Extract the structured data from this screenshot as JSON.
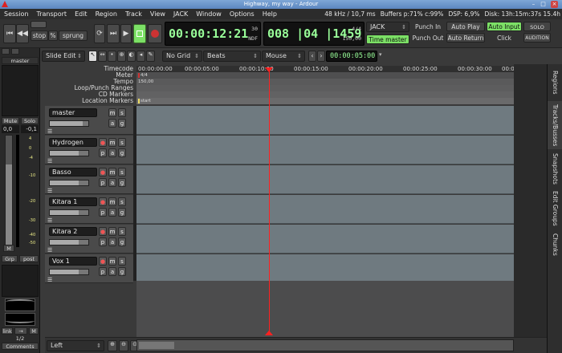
{
  "window": {
    "title": "Highway, my way - Ardour"
  },
  "menu": {
    "items": [
      "Session",
      "Transport",
      "Edit",
      "Region",
      "Track",
      "View",
      "JACK",
      "Window",
      "Options",
      "Help"
    ]
  },
  "status": {
    "samplerate": "48 kHz / 10,7 ms",
    "buffers": "Buffers p:71% c:99%",
    "dsp_label": "DSP:",
    "dsp_value": "6,9%",
    "disk": "Disk: 13h:15m:37s 15.4h"
  },
  "transport": {
    "stop_label": "stop",
    "percent_label": "%",
    "sprung_label": "sprung",
    "primary_clock": "00:00:12:21",
    "primary_clock_fps": "30",
    "primary_clock_mode": "NDF",
    "secondary_clock": "008 |04 |1459",
    "secondary_clock_meter": "4/4",
    "secondary_clock_tempo": "150,00",
    "sync_source": "JACK",
    "time_master_label": "Time master",
    "punch_in_label": "Punch In",
    "punch_out_label": "Punch Out",
    "auto_play_label": "Auto Play",
    "auto_return_label": "Auto Return",
    "auto_input_label": "Auto Input",
    "click_label": "Click",
    "solo_label": "SOLO",
    "audition_label": "AUDITION"
  },
  "edit_toolbar": {
    "edit_mode": "Slide Edit",
    "grid_mode": "No Grid",
    "grid_unit": "Beats",
    "snap_mode": "Mouse",
    "nudge_clock": "00:00:05:00"
  },
  "strip": {
    "name": "master",
    "mute_label": "Mute",
    "solo_label": "Solo",
    "gain_value": "0,0",
    "peak_value": "-0,1",
    "meter_scale": [
      "4",
      "0",
      "-4",
      "-10",
      "-20",
      "-30",
      "-40",
      "-50"
    ],
    "m_label": "M",
    "grp_label": "Grp",
    "post_label": "post",
    "link_label": "link",
    "m2_label": "M",
    "page_label": "1/2",
    "comments_label": "Comments"
  },
  "rulers": {
    "timecode_label": "Timecode",
    "meter_label": "Meter",
    "tempo_label": "Tempo",
    "loop_punch_label": "Loop/Punch Ranges",
    "cd_markers_label": "CD Markers",
    "location_markers_label": "Location Markers",
    "timecode_ticks": [
      "00:00:00:00",
      "00:00:05:00",
      "00:00:10:00",
      "00:00:15:00",
      "00:00:20:00",
      "00:00:25:00",
      "00:00:30:00",
      "00:00"
    ],
    "meter_marker": "4/4",
    "tempo_marker": "150,00",
    "start_marker": "start"
  },
  "tracks": [
    {
      "name": "master",
      "buttons": [
        "m",
        "s",
        "a",
        "g"
      ],
      "gain": 0.85
    },
    {
      "name": "Hydrogen",
      "buttons": [
        "m",
        "s",
        "p",
        "a",
        "g"
      ],
      "gain": 0.75
    },
    {
      "name": "Basso",
      "buttons": [
        "m",
        "s",
        "p",
        "a",
        "g"
      ],
      "gain": 0.75
    },
    {
      "name": "Kitara 1",
      "buttons": [
        "m",
        "s",
        "p",
        "a",
        "g"
      ],
      "gain": 0.75
    },
    {
      "name": "Kitara 2",
      "buttons": [
        "m",
        "s",
        "p",
        "a",
        "g"
      ],
      "gain": 0.75
    },
    {
      "name": "Vox 1",
      "buttons": [
        "m",
        "s",
        "p",
        "a",
        "g"
      ],
      "gain": 0.75
    }
  ],
  "sidebar": {
    "tabs": [
      "Regions",
      "Tracks/Busses",
      "Snapshots",
      "Edit Groups",
      "Chunks"
    ]
  },
  "bottom": {
    "zoom_focus": "Left"
  },
  "playhead": {
    "position": 0.35
  },
  "colors": {
    "playhead": "#ff2020",
    "clock_green": "#99ff99",
    "active_green": "#7ce066",
    "record_red": "#e55555"
  }
}
